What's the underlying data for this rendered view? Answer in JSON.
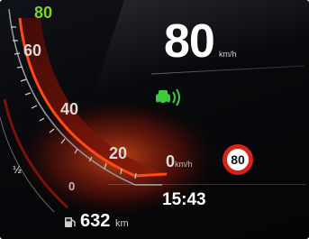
{
  "speedometer": {
    "ticks": [
      "80",
      "60",
      "40",
      "20"
    ],
    "zero_value": "0",
    "zero_unit": "km/h",
    "small_ticks": [
      "½",
      "0"
    ]
  },
  "digital_speed": {
    "value": "80",
    "unit": "km/h"
  },
  "speed_limit": {
    "value": "80"
  },
  "clock": {
    "time": "15:43"
  },
  "range": {
    "value": "632",
    "unit": "km"
  },
  "icons": {
    "driver_assist": "driver-assist-icon",
    "fuel": "fuel-icon"
  },
  "colors": {
    "needle_glow": "#ff3a10",
    "assist_green": "#3fc93f",
    "limit_red": "#d6221a",
    "speed_tick_green": "#7ed321"
  }
}
